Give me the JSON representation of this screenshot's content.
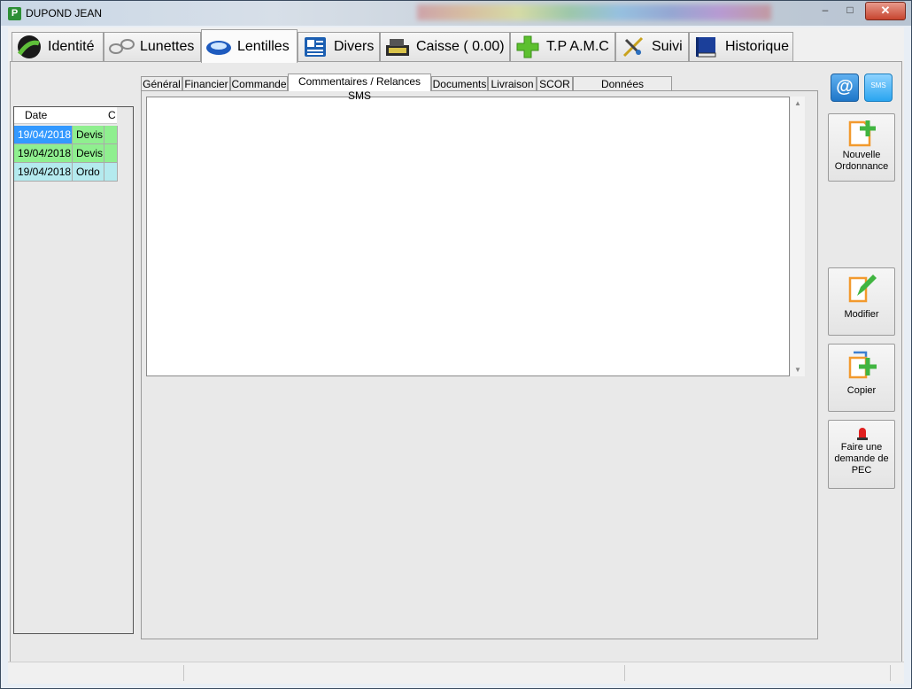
{
  "window": {
    "title": "DUPOND JEAN",
    "close_label": "✕"
  },
  "main_tabs": [
    {
      "label": "Identité",
      "icon": "road-icon"
    },
    {
      "label": "Lunettes",
      "icon": "glasses-icon"
    },
    {
      "label": "Lentilles",
      "icon": "contact-lens-icon"
    },
    {
      "label": "Divers",
      "icon": "document-list-icon"
    },
    {
      "label": "Caisse ( 0.00)",
      "icon": "cash-register-icon"
    },
    {
      "label": "T.P A.M.C",
      "icon": "green-cross-icon"
    },
    {
      "label": "Suivi",
      "icon": "tools-icon"
    },
    {
      "label": "Historique",
      "icon": "book-icon"
    }
  ],
  "active_main_tab": "Lentilles",
  "left_list": {
    "columns": [
      "Date",
      "C"
    ],
    "rows": [
      {
        "date": "19/04/2018",
        "type": "Devis",
        "selected": true,
        "color": "#8fef8f"
      },
      {
        "date": "19/04/2018",
        "type": "Devis",
        "selected": false,
        "color": "#8fef8f"
      },
      {
        "date": "19/04/2018",
        "type": "Ordo",
        "selected": false,
        "color": "#b4eaee"
      }
    ]
  },
  "sub_tabs": [
    "Général",
    "Financier",
    "Commande",
    "Commentaires / Relances SMS",
    "Documents",
    "Livraison",
    "SCOR",
    "Données Normalisées"
  ],
  "active_sub_tab": "Commentaires / Relances SMS",
  "comment_text": "",
  "top_icons": {
    "email": "@",
    "sms": "SMS"
  },
  "side_buttons": {
    "nouvelle_ordonnance": "Nouvelle Ordonnance",
    "modifier": "Modifier",
    "copier": "Copier",
    "pec": "Faire une demande de PEC"
  },
  "colors": {
    "selection": "#3399ff",
    "devis": "#8fef8f",
    "ordo": "#b4eaee",
    "accent_orange": "#f29a2e",
    "accent_green": "#41b541"
  }
}
